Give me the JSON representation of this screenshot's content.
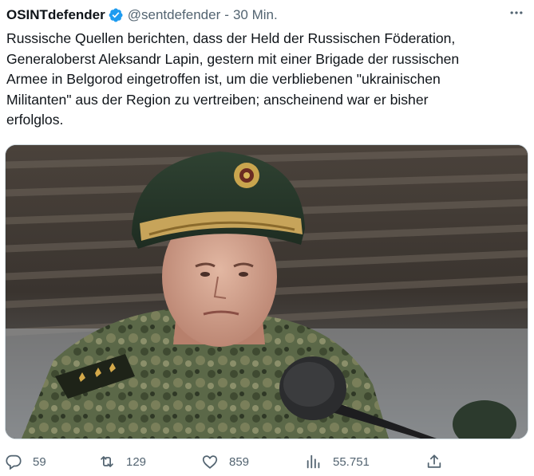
{
  "author": {
    "name": "OSINTdefender",
    "handle": "@sentdefender",
    "separator": "-",
    "time": "30 Min."
  },
  "tweet": {
    "lines": [
      "Russische Quellen berichten, dass der Held der Russischen Föderation,",
      "Generaloberst Aleksandr Lapin, gestern mit einer Brigade der russischen",
      "Armee in Belgorod eingetroffen ist, um die verbliebenen \"ukrainischen",
      "Militanten\" aus der Region zu vertreiben; anscheinend war er bisher",
      "erfolglos."
    ]
  },
  "media": {
    "description_icon": "photo-of-officer-at-microphone"
  },
  "actions": {
    "replies": "59",
    "retweets": "129",
    "likes": "859",
    "views": "55.751"
  },
  "icons": {
    "more": "more-dots-icon",
    "verified": "verified-badge-icon",
    "reply": "reply-icon",
    "retweet": "retweet-icon",
    "like": "heart-icon",
    "views": "views-icon",
    "share": "share-icon"
  },
  "colors": {
    "text": "#0f1419",
    "secondary": "#536471",
    "verified": "#1d9bf0"
  }
}
